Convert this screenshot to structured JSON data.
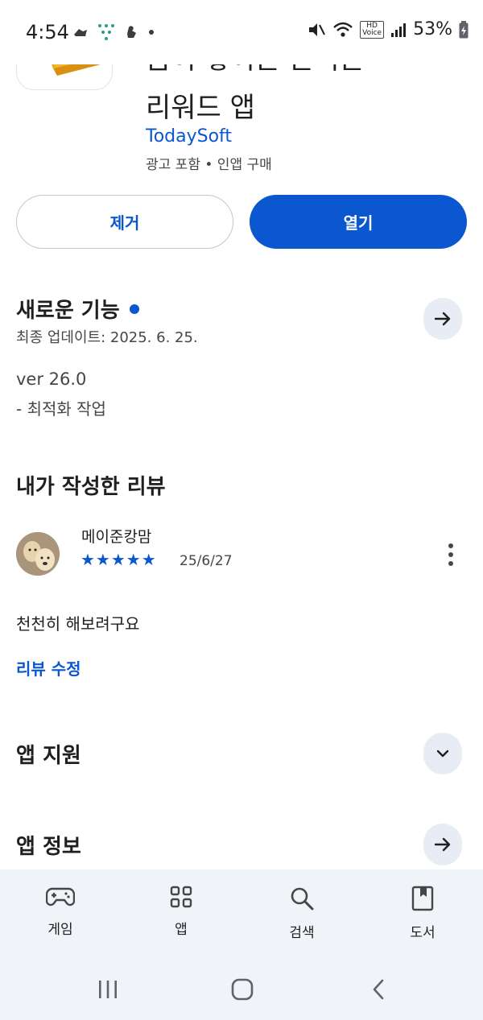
{
  "status_bar": {
    "time": "4:54",
    "battery": "53%"
  },
  "app": {
    "title_lines": [
      "금이 쌓이는 돈버는",
      "리워드 앱"
    ],
    "developer": "TodaySoft",
    "ad_info": "광고 포함 • 인앱 구매"
  },
  "actions": {
    "remove_label": "제거",
    "open_label": "열기"
  },
  "whats_new": {
    "title": "새로운 기능",
    "updated": "최종 업데이트: 2025. 6. 25.",
    "version": "ver 26.0",
    "notes": "- 최적화 작업"
  },
  "my_review": {
    "title": "내가 작성한 리뷰",
    "reviewer": "메이준캉맘",
    "rating": 5,
    "stars": "★★★★★",
    "date": "25/6/27",
    "text": "천천히 해보려구요",
    "edit_label": "리뷰 수정"
  },
  "app_support": {
    "title": "앱 지원"
  },
  "app_info": {
    "title": "앱 정보"
  },
  "bottom_nav": {
    "items": [
      {
        "label": "게임",
        "icon": "gamepad-icon"
      },
      {
        "label": "앱",
        "icon": "apps-grid-icon"
      },
      {
        "label": "검색",
        "icon": "search-icon"
      },
      {
        "label": "도서",
        "icon": "book-icon"
      }
    ]
  },
  "colors": {
    "accent": "#0b57d0",
    "nav_background": "#f0f3f8",
    "round_button": "#e8ecf4"
  }
}
